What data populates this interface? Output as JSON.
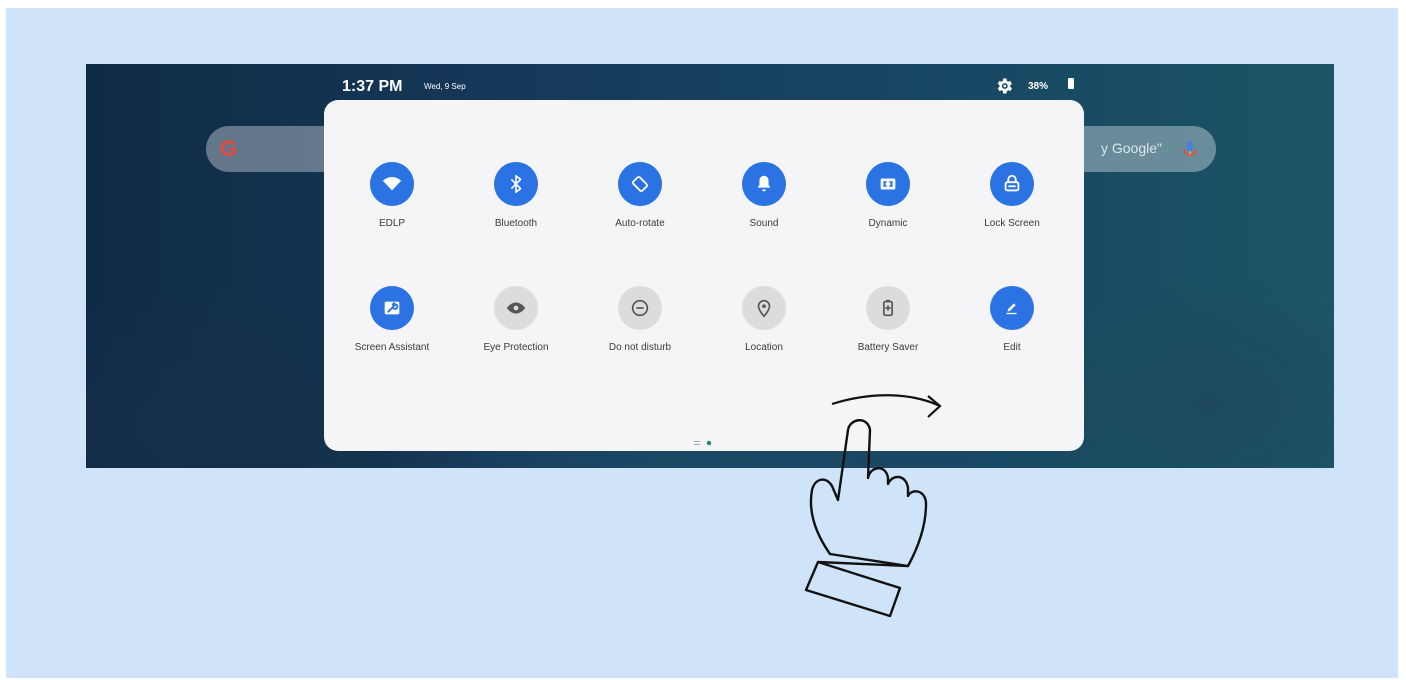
{
  "status_bar": {
    "time": "1:37 PM",
    "date": "Wed, 9 Sep",
    "battery": "38%",
    "icons": [
      "gear-icon",
      "battery-icon"
    ]
  },
  "search": {
    "logo": "G",
    "placeholder_visible": "y Google\"",
    "icons": [
      "google-g-icon",
      "microphone-icon"
    ]
  },
  "quick_settings": {
    "row1": [
      {
        "label": "EDLP",
        "icon": "wifi-icon",
        "active": true
      },
      {
        "label": "Bluetooth",
        "icon": "bluetooth-icon",
        "active": true
      },
      {
        "label": "Auto-rotate",
        "icon": "auto-rotate-icon",
        "active": true
      },
      {
        "label": "Sound",
        "icon": "bell-icon",
        "active": true
      },
      {
        "label": "Dynamic",
        "icon": "dynamic-icon",
        "active": true
      },
      {
        "label": "Lock Screen",
        "icon": "lock-icon",
        "active": true
      }
    ],
    "row2": [
      {
        "label": "Screen Assistant",
        "icon": "wrench-icon",
        "active": true
      },
      {
        "label": "Eye Protection",
        "icon": "eye-icon",
        "active": false
      },
      {
        "label": "Do not disturb",
        "icon": "minus-circle-icon",
        "active": false
      },
      {
        "label": "Location",
        "icon": "location-pin-icon",
        "active": false
      },
      {
        "label": "Battery Saver",
        "icon": "battery-saver-icon",
        "active": false
      },
      {
        "label": "Edit",
        "icon": "pencil-icon",
        "active": true
      }
    ],
    "page_indicator": {
      "pages": 2,
      "current": 2
    }
  },
  "overlay": {
    "gesture": "swipe-right",
    "icons": [
      "swipe-arrow-icon",
      "pointing-hand-icon"
    ]
  },
  "colors": {
    "background": "#cfe4f8",
    "accent": "#2b73e2",
    "panel": "#f5f4f6",
    "inactive_tile": "#dcdcdc",
    "page_dot": "#1a8a7a"
  }
}
